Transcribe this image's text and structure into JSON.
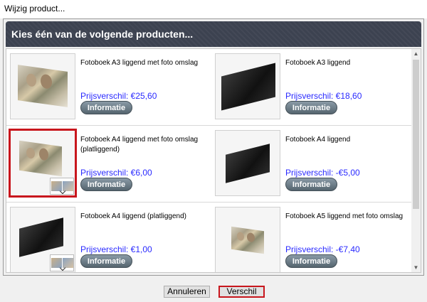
{
  "window": {
    "title": "Wijzig product..."
  },
  "header": {
    "title": "Kies één van de volgende producten..."
  },
  "products": [
    {
      "name": "Fotoboek A3 liggend met foto omslag",
      "price": "Prijsverschil: €25,60",
      "info_label": "Informatie",
      "cover": "photo",
      "selected": false
    },
    {
      "name": "Fotoboek A3 liggend",
      "price": "Prijsverschil: €18,60",
      "info_label": "Informatie",
      "cover": "dark",
      "selected": false
    },
    {
      "name": "Fotoboek A4 liggend met foto omslag (platliggend)",
      "price": "Prijsverschil: €6,00",
      "info_label": "Informatie",
      "cover": "photo",
      "selected": true
    },
    {
      "name": "Fotoboek A4 liggend",
      "price": "Prijsverschil: -€5,00",
      "info_label": "Informatie",
      "cover": "dark",
      "selected": false
    },
    {
      "name": "Fotoboek A4 liggend (platliggend)",
      "price": "Prijsverschil: €1,00",
      "info_label": "Informatie",
      "cover": "dark",
      "selected": false
    },
    {
      "name": "Fotoboek A5 liggend met foto omslag",
      "price": "Prijsverschil: -€7,40",
      "info_label": "Informatie",
      "cover": "photo",
      "selected": false
    }
  ],
  "buttons": {
    "cancel": "Annuleren",
    "confirm": "Verschil"
  },
  "scrollbar": {
    "up_icon": "▲",
    "down_icon": "▼"
  },
  "colors": {
    "header": "#3c4250",
    "price": "#2a2aff",
    "selected_border": "#c8161d"
  }
}
